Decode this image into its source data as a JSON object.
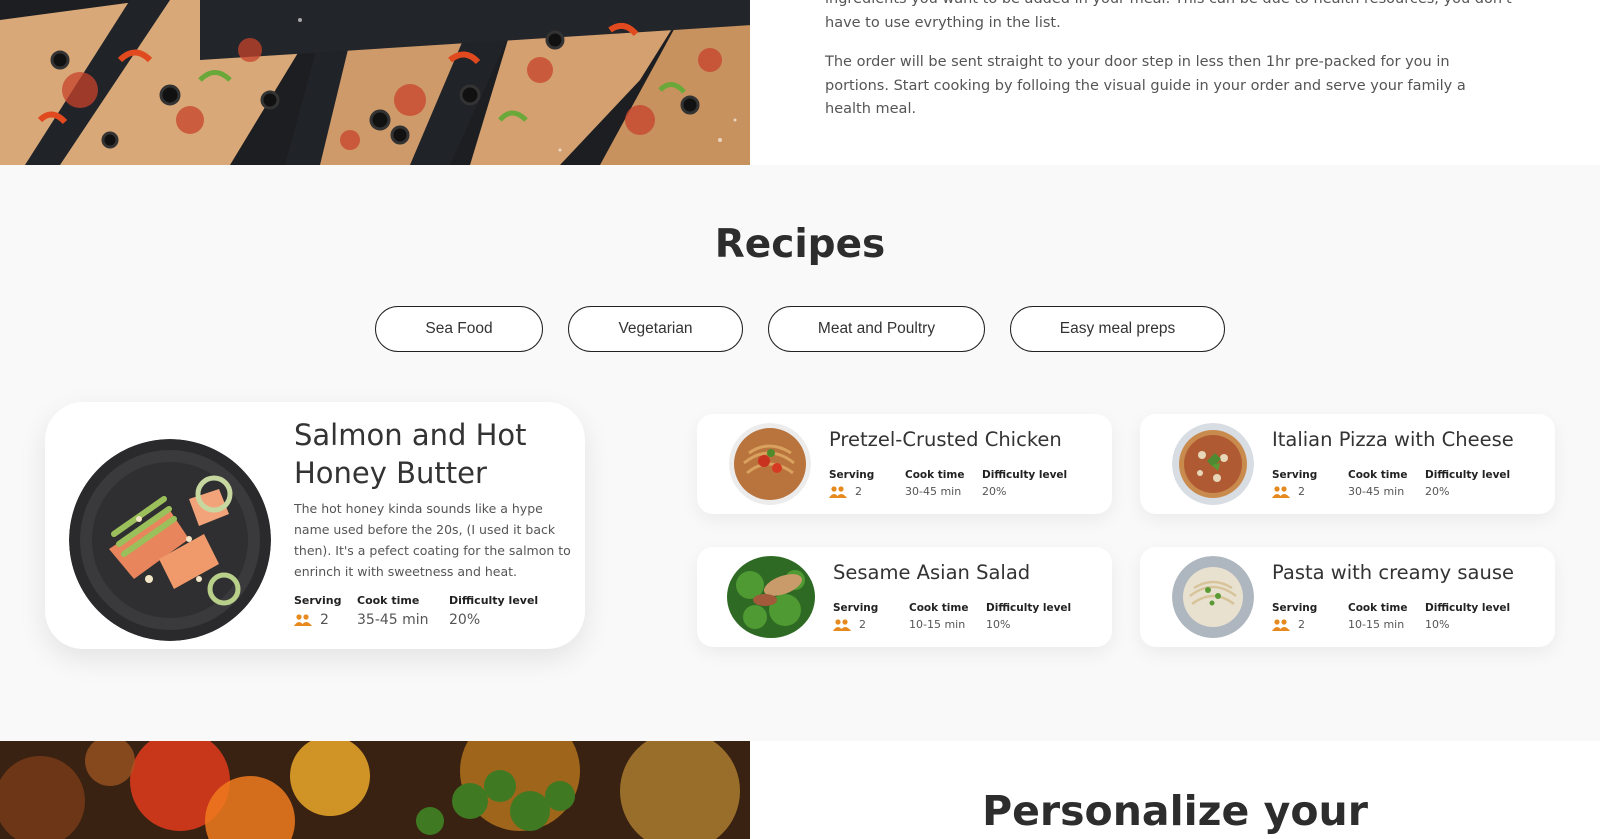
{
  "about": {
    "paragraph1": "ingredients you want to be added in your meal. This can be due to health resources, you don't have to use evrything in the list.",
    "paragraph2": "The order will be sent straight to your door step in less then 1hr pre-packed for you in portions. Start cooking by folloing the visual guide in your order and serve your family a health meal."
  },
  "recipes": {
    "title": "Recipes",
    "filters": [
      "Sea Food",
      "Vegetarian",
      "Meat and Poultry",
      "Easy meal preps"
    ],
    "labels": {
      "serving": "Serving",
      "cook_time": "Cook time",
      "difficulty": "Difficulty level"
    },
    "featured": {
      "title": "Salmon and Hot Honey Butter",
      "description": "The hot honey kinda sounds like a hype name used before the 20s, (I used it back then). It's a pefect coating for the salmon to enrinch it with sweetness and heat.",
      "serving": "2",
      "cook_time": "35-45 min",
      "difficulty": "20%",
      "image_icon": "salmon-plate-image"
    },
    "cards": [
      {
        "title": "Pretzel-Crusted Chicken",
        "serving": "2",
        "cook_time": "30-45 min",
        "difficulty": "20%",
        "image_icon": "pasta-plate-image"
      },
      {
        "title": "Italian Pizza with Cheese",
        "serving": "2",
        "cook_time": "30-45 min",
        "difficulty": "20%",
        "image_icon": "pizza-plate-image"
      },
      {
        "title": "Sesame Asian Salad",
        "serving": "2",
        "cook_time": "10-15 min",
        "difficulty": "10%",
        "image_icon": "salad-plate-image"
      },
      {
        "title": "Pasta with creamy sause",
        "serving": "2",
        "cook_time": "10-15 min",
        "difficulty": "10%",
        "image_icon": "pasta-bowl-image"
      }
    ]
  },
  "personalize": {
    "title": "Personalize your"
  },
  "colors": {
    "accent": "#e68a1f",
    "background": "#f9f9f9",
    "text": "#333333"
  }
}
